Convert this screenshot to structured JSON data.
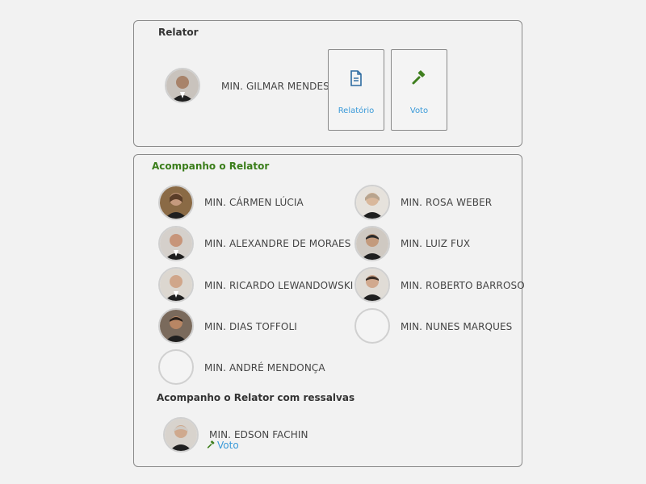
{
  "relator": {
    "title": "Relator",
    "minister": "MIN. GILMAR MENDES",
    "buttons": {
      "relatorio_label": "Relatório",
      "voto_label": "Voto"
    }
  },
  "acompanho": {
    "title": "Acompanho o Relator",
    "ministers": [
      "MIN. CÁRMEN LÚCIA",
      "MIN. ROSA WEBER",
      "MIN. ALEXANDRE DE MORAES",
      "MIN. LUIZ FUX",
      "MIN. RICARDO LEWANDOWSKI",
      "MIN. ROBERTO BARROSO",
      "MIN. DIAS TOFFOLI",
      "MIN. NUNES MARQUES",
      "MIN. ANDRÉ MENDONÇA"
    ]
  },
  "ressalvas": {
    "title": "Acompanho o Relator com ressalvas",
    "minister": "MIN. EDSON FACHIN",
    "voto_label": "Voto"
  },
  "colors": {
    "accent_blue": "#3a9ad9",
    "green_title": "#3a7d1a",
    "gavel_green": "#3f7f1e",
    "doc_icon_blue": "#2c6aa0",
    "border": "#8a8a8a"
  },
  "icons": {
    "relatorio": "document-icon",
    "voto": "gavel-icon"
  }
}
